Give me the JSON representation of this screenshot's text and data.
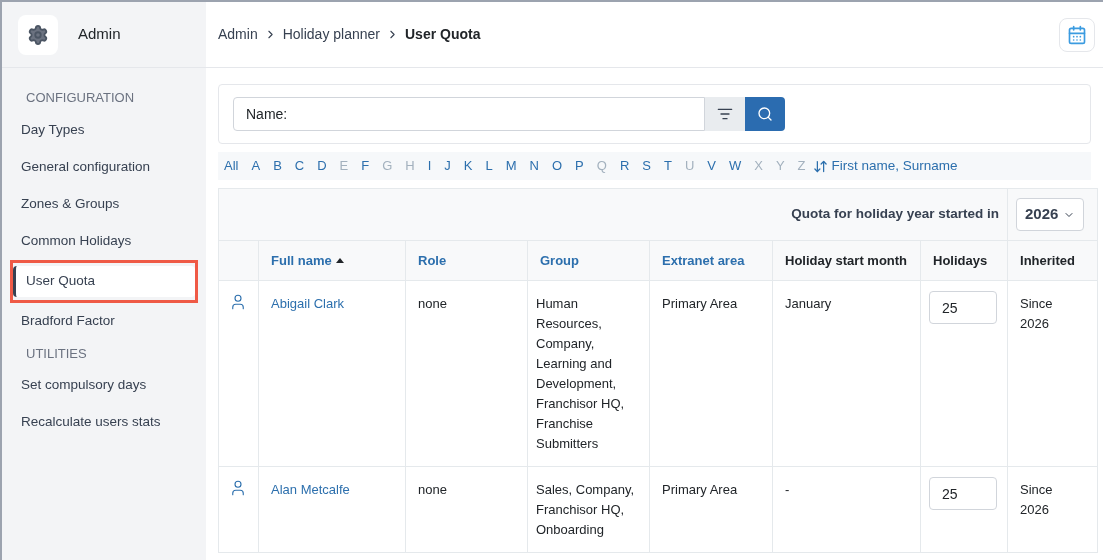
{
  "sidebar": {
    "title": "Admin",
    "sections": [
      {
        "heading": "CONFIGURATION",
        "items": [
          {
            "label": "Day Types",
            "selected": false,
            "annotated": false
          },
          {
            "label": "General configuration",
            "selected": false,
            "annotated": false
          },
          {
            "label": "Zones & Groups",
            "selected": false,
            "annotated": false
          },
          {
            "label": "Common Holidays",
            "selected": false,
            "annotated": false
          },
          {
            "label": "User Quota",
            "selected": true,
            "annotated": true
          },
          {
            "label": "Bradford Factor",
            "selected": false,
            "annotated": false
          }
        ]
      },
      {
        "heading": "UTILITIES",
        "items": [
          {
            "label": "Set compulsory days",
            "selected": false,
            "annotated": false
          },
          {
            "label": "Recalculate users stats",
            "selected": false,
            "annotated": false
          }
        ]
      }
    ]
  },
  "breadcrumb": [
    "Admin",
    "Holiday planner",
    "User Quota"
  ],
  "search": {
    "placeholder": "Name:"
  },
  "letters": [
    {
      "label": "All",
      "disabled": false
    },
    {
      "label": "A",
      "disabled": false
    },
    {
      "label": "B",
      "disabled": false
    },
    {
      "label": "C",
      "disabled": false
    },
    {
      "label": "D",
      "disabled": false
    },
    {
      "label": "E",
      "disabled": true
    },
    {
      "label": "F",
      "disabled": false
    },
    {
      "label": "G",
      "disabled": true
    },
    {
      "label": "H",
      "disabled": true
    },
    {
      "label": "I",
      "disabled": false
    },
    {
      "label": "J",
      "disabled": false
    },
    {
      "label": "K",
      "disabled": false
    },
    {
      "label": "L",
      "disabled": false
    },
    {
      "label": "M",
      "disabled": false
    },
    {
      "label": "N",
      "disabled": false
    },
    {
      "label": "O",
      "disabled": false
    },
    {
      "label": "P",
      "disabled": false
    },
    {
      "label": "Q",
      "disabled": true
    },
    {
      "label": "R",
      "disabled": false
    },
    {
      "label": "S",
      "disabled": false
    },
    {
      "label": "T",
      "disabled": false
    },
    {
      "label": "U",
      "disabled": true
    },
    {
      "label": "V",
      "disabled": false
    },
    {
      "label": "W",
      "disabled": false
    },
    {
      "label": "X",
      "disabled": true
    },
    {
      "label": "Y",
      "disabled": true
    },
    {
      "label": "Z",
      "disabled": true
    }
  ],
  "sort_link": "First name, Surname",
  "table": {
    "quota_label": "Quota for holiday year started in",
    "year": "2026",
    "columns": [
      {
        "label": "Full name",
        "sortable": true,
        "sorted": true
      },
      {
        "label": "Role",
        "sortable": true,
        "sorted": false
      },
      {
        "label": "Group",
        "sortable": true,
        "sorted": false
      },
      {
        "label": "Extranet area",
        "sortable": true,
        "sorted": false
      },
      {
        "label": "Holiday start month",
        "sortable": false
      },
      {
        "label": "Holidays",
        "sortable": false
      },
      {
        "label": "Inherited",
        "sortable": false
      }
    ],
    "rows": [
      {
        "name": "Abigail Clark",
        "role": "none",
        "group": "Human Resources, Company, Learning and Development, Franchisor HQ, Franchise Submitters",
        "area": "Primary Area",
        "month": "January",
        "holidays": "25",
        "inherited": "Since 2026"
      },
      {
        "name": "Alan Metcalfe",
        "role": "none",
        "group": "Sales, Company, Franchisor HQ, Onboarding",
        "area": "Primary Area",
        "month": "-",
        "holidays": "25",
        "inherited": "Since 2026"
      }
    ]
  }
}
